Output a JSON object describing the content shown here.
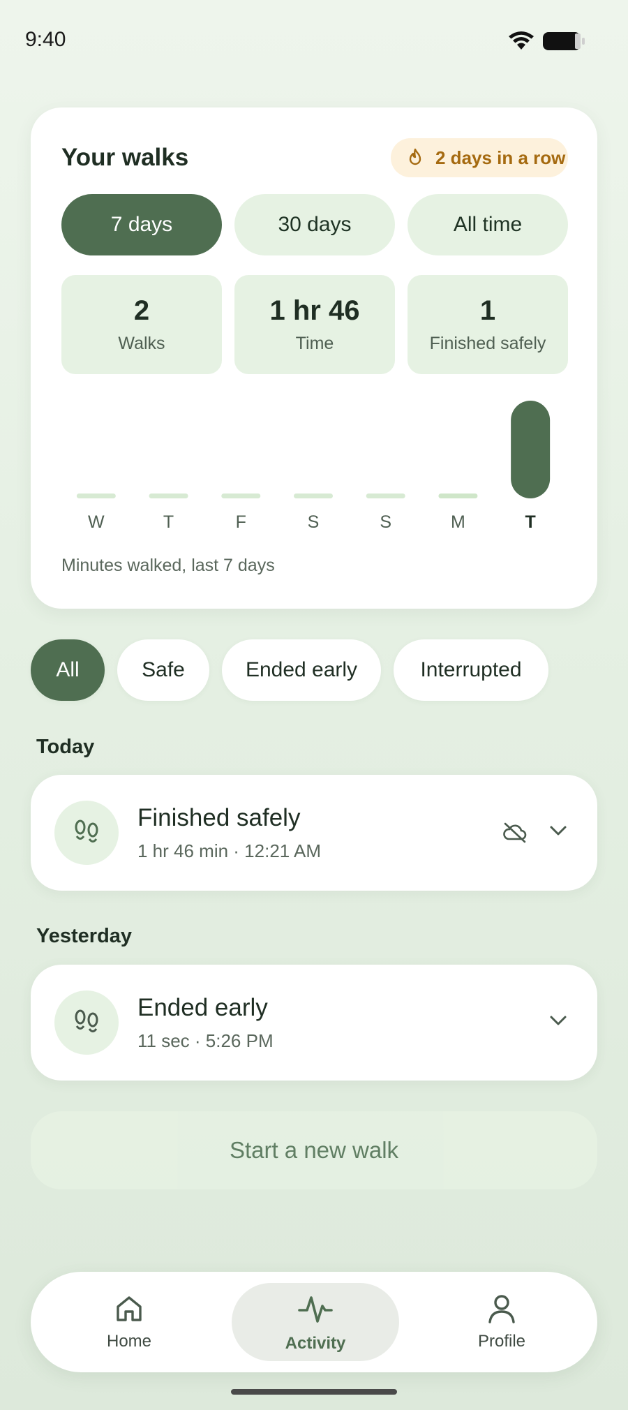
{
  "status_bar": {
    "time": "9:40"
  },
  "summary": {
    "title": "Your walks",
    "streak": "2 days in a row",
    "ranges": [
      "7 days",
      "30 days",
      "All time"
    ],
    "active_range": "7 days",
    "stats": [
      {
        "value": "2",
        "label": "Walks"
      },
      {
        "value": "1 hr 46",
        "label": "Time"
      },
      {
        "value": "1",
        "label": "Finished safely"
      }
    ],
    "caption": "Minutes walked, last 7 days"
  },
  "chart_data": {
    "type": "bar",
    "categories": [
      "W",
      "T",
      "F",
      "S",
      "S",
      "M",
      "T"
    ],
    "values": [
      0,
      0,
      0,
      0,
      0,
      0.2,
      106
    ],
    "highlight_index": 6,
    "colors": {
      "active": "#4f6e51",
      "inactive": "#d7ead3"
    }
  },
  "filters": {
    "items": [
      "All",
      "Safe",
      "Ended early",
      "Interrupted"
    ],
    "active": "All"
  },
  "sections": {
    "today": "Today",
    "yesterday": "Yesterday"
  },
  "walks": [
    {
      "title": "Finished safely",
      "subtitle": "1 hr 46 min · 12:21 AM",
      "icon": "footprints-icon",
      "hidden_icon": "cloud-off-icon"
    },
    {
      "title": "Ended early",
      "subtitle": "11 sec · 5:26 PM",
      "icon": "footprints-icon"
    }
  ],
  "start_button": "Start a new walk",
  "nav": {
    "items": [
      {
        "label": "Home",
        "icon": "home-icon"
      },
      {
        "label": "Activity",
        "icon": "activity-icon"
      },
      {
        "label": "Profile",
        "icon": "profile-icon"
      }
    ],
    "active": "Activity"
  },
  "colors": {
    "accent": "#4f6e51",
    "tint": "#e6f2e3",
    "streak": "#a56a10"
  }
}
